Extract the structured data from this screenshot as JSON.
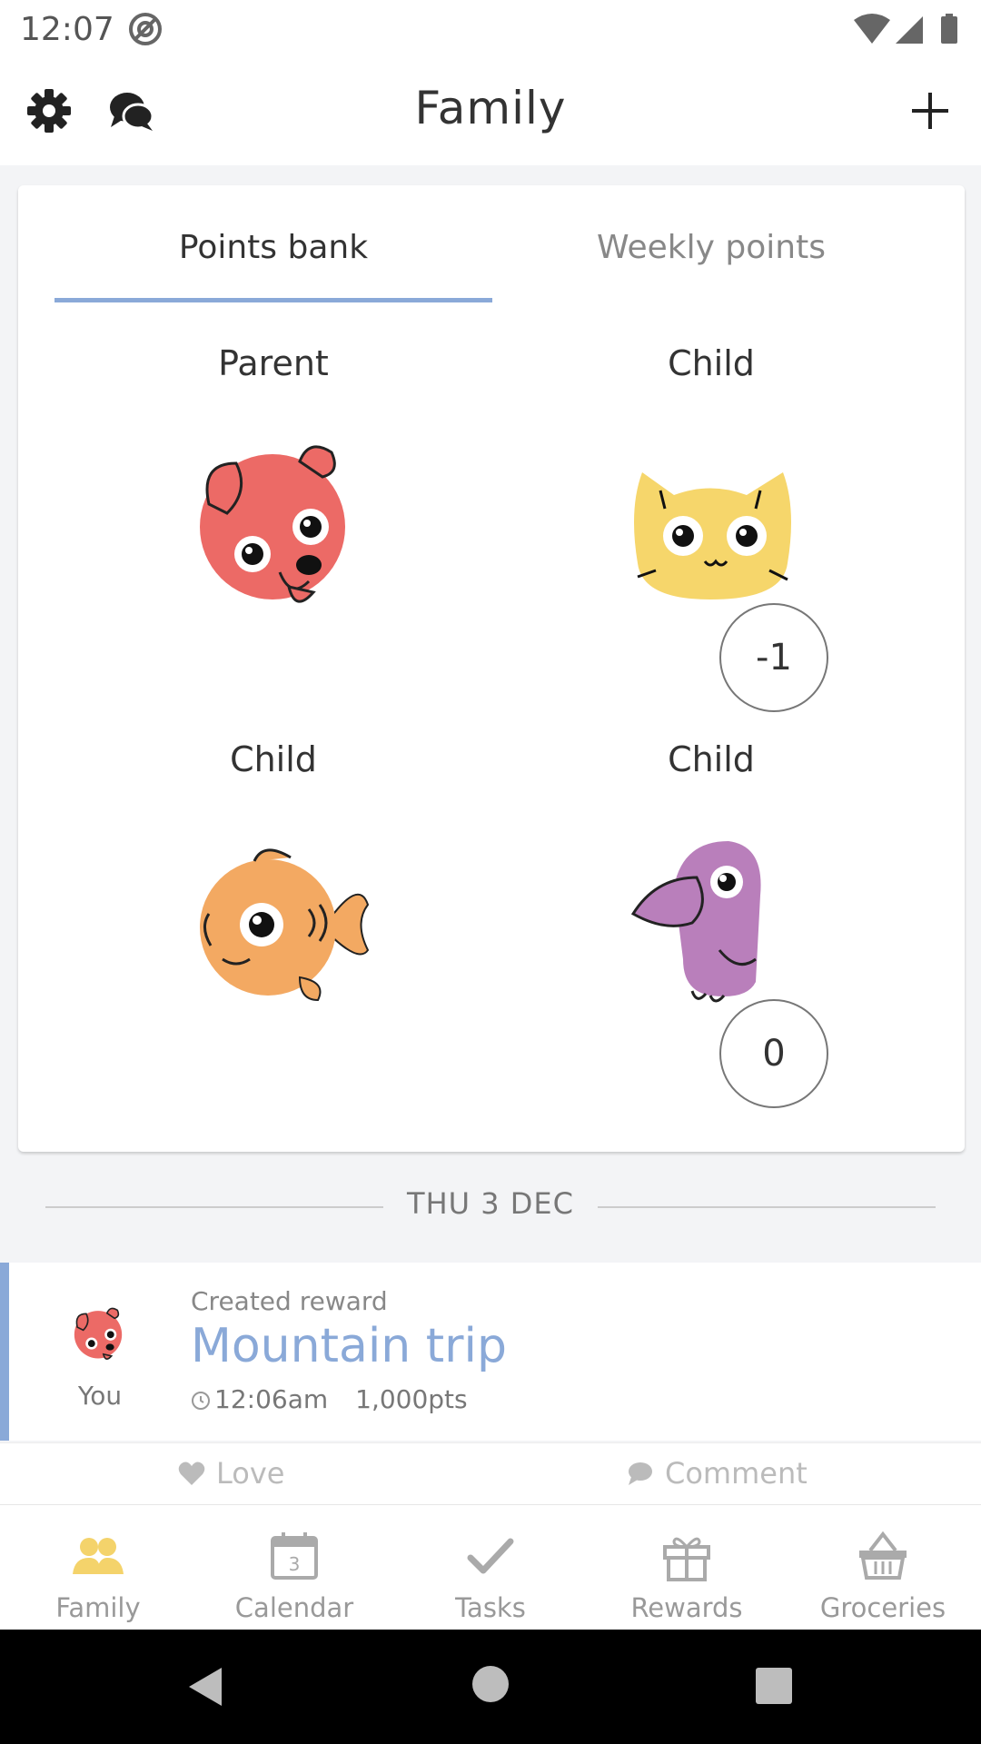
{
  "status_bar": {
    "time": "12:07"
  },
  "app_bar": {
    "title": "Family"
  },
  "tabs": [
    {
      "label": "Points bank",
      "active": true
    },
    {
      "label": "Weekly points",
      "active": false
    }
  ],
  "members": [
    {
      "role": "Parent",
      "avatar": "dog-avatar",
      "points": null
    },
    {
      "role": "Child",
      "avatar": "cat-avatar",
      "points": "-1"
    },
    {
      "role": "Child",
      "avatar": "fish-avatar",
      "points": null
    },
    {
      "role": "Child",
      "avatar": "bird-avatar",
      "points": "0"
    }
  ],
  "date_separator": "THU 3 DEC",
  "feed": {
    "author": "You",
    "action": "Created reward",
    "title": "Mountain trip",
    "time": "12:06am",
    "points": "1,000pts",
    "love_label": "Love",
    "comment_label": "Comment"
  },
  "bottom_nav": [
    {
      "label": "Family",
      "icon": "family-icon",
      "active": true
    },
    {
      "label": "Calendar",
      "icon": "calendar-icon",
      "active": false
    },
    {
      "label": "Tasks",
      "icon": "check-icon",
      "active": false
    },
    {
      "label": "Rewards",
      "icon": "gift-icon",
      "active": false
    },
    {
      "label": "Groceries",
      "icon": "basket-icon",
      "active": false
    }
  ],
  "colors": {
    "accent": "#8aa9d8",
    "family_active": "#f4d36b",
    "dog": "#ec6a66",
    "cat": "#f6d66b",
    "fish": "#f3a962",
    "bird": "#b97fbb"
  }
}
